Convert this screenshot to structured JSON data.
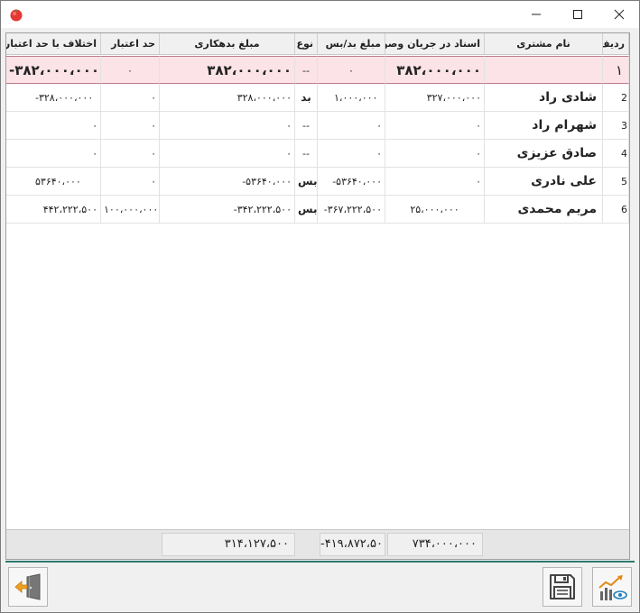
{
  "window": {
    "title": ""
  },
  "columns": {
    "index": "ردیف",
    "customer": "نام مشتری",
    "checks": "اسناد در جریان وصول",
    "balance": "مبلغ بد/بس",
    "type": "نوع",
    "debt": "مبلغ بدهکاری",
    "limit": "حد اعتبار",
    "diff": "اختلاف با حد اعتبار"
  },
  "summary_row": {
    "index": "۱",
    "customer": "",
    "checks": "۳۸۲،۰۰۰،۰۰۰",
    "balance": "۰",
    "type": "--",
    "debt": "۳۸۲،۰۰۰،۰۰۰",
    "limit": "۰",
    "diff": "-۳۸۲،۰۰۰،۰۰۰"
  },
  "rows": [
    {
      "index": "2",
      "customer": "شادی راد",
      "checks": "۳۲۷،۰۰۰،۰۰۰",
      "balance": "۱،۰۰۰،۰۰۰",
      "type": "بد",
      "debt": "۳۲۸،۰۰۰،۰۰۰",
      "limit": "۰",
      "diff": "-۳۲۸،۰۰۰،۰۰۰"
    },
    {
      "index": "3",
      "customer": "شهرام راد",
      "checks": "۰",
      "balance": "۰",
      "type": "--",
      "debt": "۰",
      "limit": "۰",
      "diff": "۰"
    },
    {
      "index": "4",
      "customer": "صادق عزیزی",
      "checks": "۰",
      "balance": "۰",
      "type": "--",
      "debt": "۰",
      "limit": "۰",
      "diff": "۰"
    },
    {
      "index": "5",
      "customer": "علی نادری",
      "checks": "۰",
      "balance": "-۵۳۶۴۰،۰۰۰",
      "type": "بس",
      "debt": "-۵۳۶۴۰،۰۰۰",
      "limit": "۰",
      "diff": "۵۳۶۴۰،۰۰۰"
    },
    {
      "index": "6",
      "customer": "مریم محمدی",
      "checks": "۲۵،۰۰۰،۰۰۰",
      "balance": "-۳۶۷،۲۲۲،۵۰۰",
      "type": "بس",
      "debt": "-۳۴۲،۲۲۲،۵۰۰",
      "limit": "۱۰۰،۰۰۰،۰۰۰",
      "diff": "۴۴۲،۲۲۲،۵۰۰"
    }
  ],
  "totals": {
    "checks": "۷۳۴،۰۰۰،۰۰۰",
    "balance": "-۴۱۹،۸۷۲،۵۰۰",
    "debt": "۳۱۴،۱۲۷،۵۰۰"
  },
  "icons": {
    "app": "tomato-icon",
    "minimize": "minimize-icon",
    "maximize": "maximize-icon",
    "close": "close-icon",
    "exit": "exit-door-icon",
    "save": "floppy-disk-icon",
    "chart": "chart-eye-icon"
  },
  "colors": {
    "selected_row": "#fbe3e8",
    "accent_divider": "#2e7a6e",
    "exit_arrow": "#f0a020"
  }
}
